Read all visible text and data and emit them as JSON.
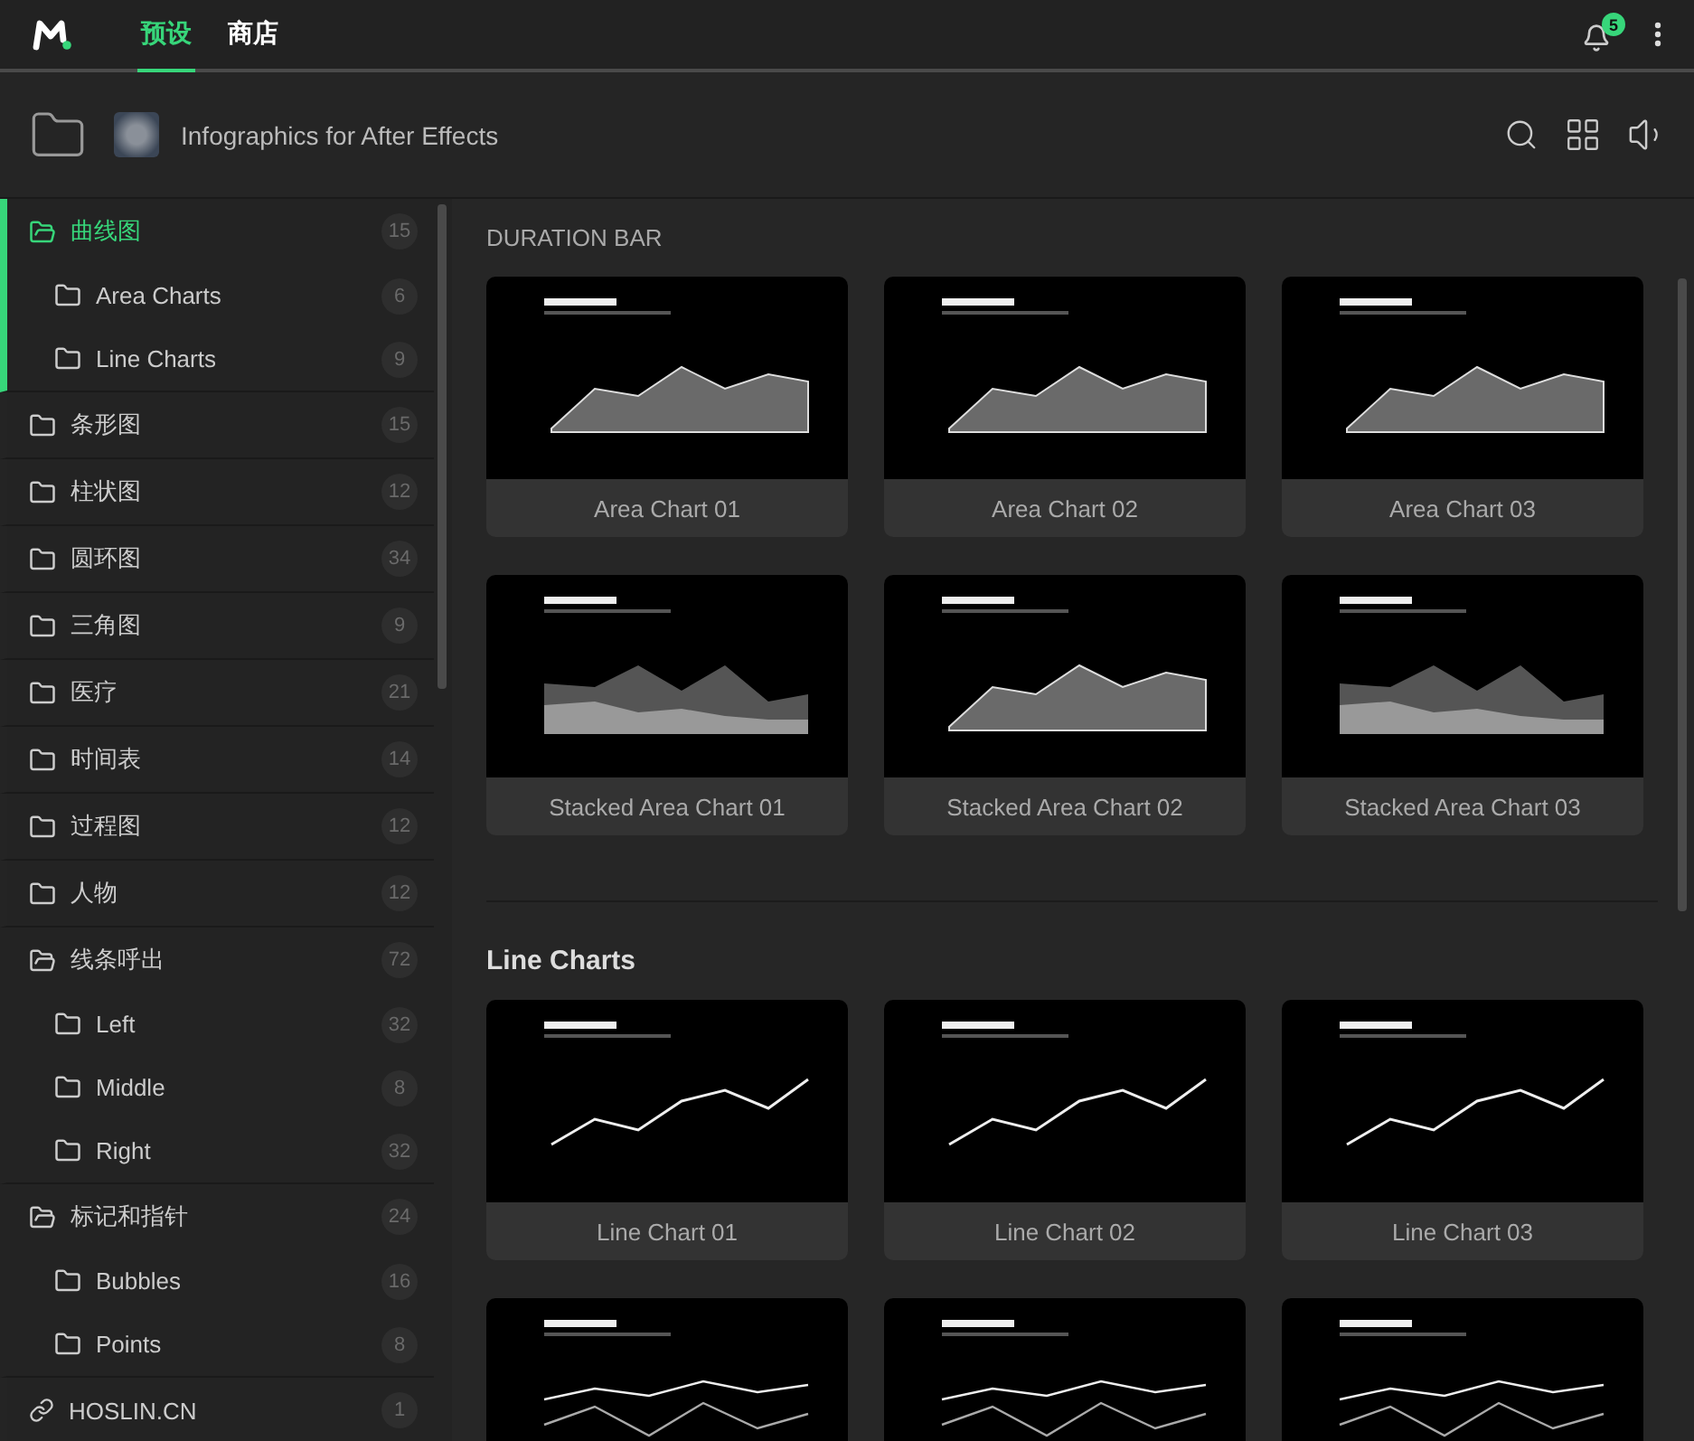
{
  "app_bar": {
    "tabs": [
      {
        "label": "预设",
        "selected": true
      },
      {
        "label": "商店",
        "selected": false
      }
    ],
    "notification_count": "5"
  },
  "library_bar": {
    "title": "Infographics for After Effects"
  },
  "sidebar": {
    "items": [
      {
        "kind": "folder",
        "label": "曲线图",
        "count": "15",
        "selected": true,
        "expanded": true,
        "children": [
          {
            "label": "Area Charts",
            "count": "6"
          },
          {
            "label": "Line Charts",
            "count": "9"
          }
        ]
      },
      {
        "kind": "folder",
        "label": "条形图",
        "count": "15",
        "selected": false,
        "expanded": false
      },
      {
        "kind": "folder",
        "label": "柱状图",
        "count": "12",
        "selected": false,
        "expanded": false
      },
      {
        "kind": "folder",
        "label": "圆环图",
        "count": "34",
        "selected": false,
        "expanded": false
      },
      {
        "kind": "folder",
        "label": "三角图",
        "count": "9",
        "selected": false,
        "expanded": false
      },
      {
        "kind": "folder",
        "label": "医疗",
        "count": "21",
        "selected": false,
        "expanded": false
      },
      {
        "kind": "folder",
        "label": "时间表",
        "count": "14",
        "selected": false,
        "expanded": false
      },
      {
        "kind": "folder",
        "label": "过程图",
        "count": "12",
        "selected": false,
        "expanded": false
      },
      {
        "kind": "folder",
        "label": "人物",
        "count": "12",
        "selected": false,
        "expanded": false
      },
      {
        "kind": "folder",
        "label": "线条呼出",
        "count": "72",
        "selected": false,
        "expanded": true,
        "children": [
          {
            "label": "Left",
            "count": "32"
          },
          {
            "label": "Middle",
            "count": "8"
          },
          {
            "label": "Right",
            "count": "32"
          }
        ]
      },
      {
        "kind": "folder",
        "label": "标记和指针",
        "count": "24",
        "selected": false,
        "expanded": true,
        "children": [
          {
            "label": "Bubbles",
            "count": "16"
          },
          {
            "label": "Points",
            "count": "8"
          }
        ]
      },
      {
        "kind": "link",
        "label": "HOSLIN.CN",
        "count": "1",
        "selected": false,
        "expanded": false
      }
    ]
  },
  "sections": [
    {
      "kind": "caps",
      "title": "DURATION BAR",
      "cards": [
        {
          "label": "Area Chart 01",
          "kind": "area"
        },
        {
          "label": "Area Chart 02",
          "kind": "area"
        },
        {
          "label": "Area Chart 03",
          "kind": "area"
        },
        {
          "label": "Stacked Area Chart 01",
          "kind": "stacked"
        },
        {
          "label": "Stacked Area Chart 02",
          "kind": "area"
        },
        {
          "label": "Stacked Area Chart 03",
          "kind": "stacked"
        }
      ]
    },
    {
      "kind": "bold",
      "title": "Line Charts",
      "cards": [
        {
          "label": "Line Chart 01",
          "kind": "line"
        },
        {
          "label": "Line Chart 02",
          "kind": "line"
        },
        {
          "label": "Line Chart 03",
          "kind": "line"
        },
        {
          "kind": "multiline"
        },
        {
          "kind": "multiline"
        },
        {
          "kind": "multiline"
        }
      ]
    }
  ]
}
